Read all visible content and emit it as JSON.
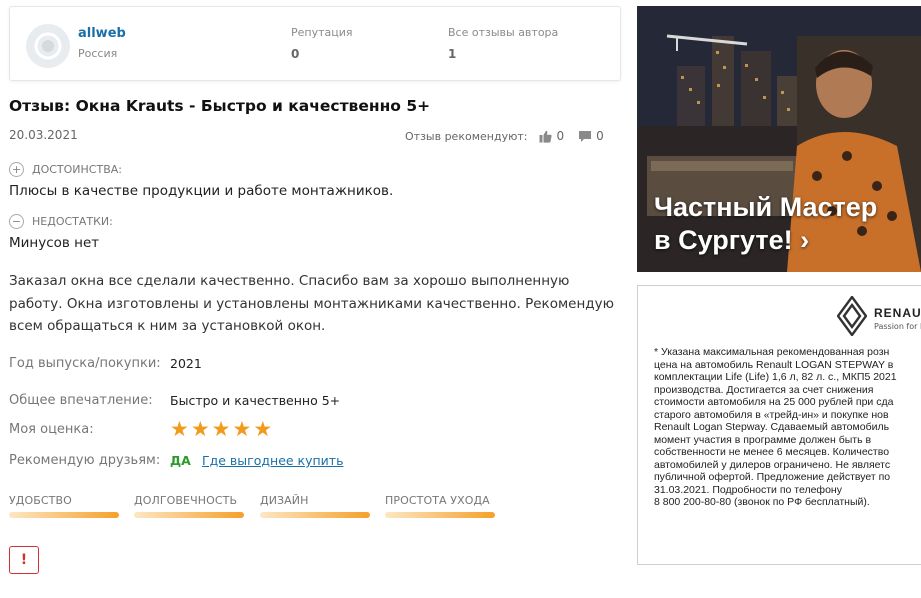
{
  "author": {
    "name": "allweb",
    "country": "Россия",
    "reputation_label": "Репутация",
    "reputation_value": "0",
    "reviews_label": "Все отзывы автора",
    "reviews_value": "1"
  },
  "review": {
    "title": "Отзыв: Окна Krauts - Быстро и качественно 5+",
    "date": "20.03.2021",
    "recommend_label": "Отзыв рекомендуют:",
    "likes": "0",
    "comments": "0",
    "pros_label": "ДОСТОИНСТВА:",
    "pros_text": "Плюсы в качестве продукции и работе монтажников.",
    "cons_label": "НЕДОСТАТКИ:",
    "cons_text": "Минусов нет",
    "body": "Заказал окна все сделали качественно. Спасибо вам за хорошо выполненную работу. Окна изготовлены и установлены монтажниками качественно. Рекомендую всем обращаться к ним за установкой окон.",
    "year_label": "Год выпуска/покупки:",
    "year_value": "2021",
    "impression_label": "Общее впечатление:",
    "impression_value": "Быстро и качественно 5+",
    "rating_label": "Моя оценка:",
    "rating": 5,
    "recommend_friends_label": "Рекомендую друзьям:",
    "recommend_friends_value": "ДА",
    "buy_link": "Где выгоднее купить",
    "criteria": [
      {
        "label": "УДОБСТВО",
        "score": 1.0
      },
      {
        "label": "ДОЛГОВЕЧНОСТЬ",
        "score": 1.0
      },
      {
        "label": "ДИЗАЙН",
        "score": 1.0
      },
      {
        "label": "ПРОСТОТА УХОДА",
        "score": 1.0
      }
    ],
    "report_button": "!"
  },
  "ads": {
    "ad1_text": "Частный Мастер\nв Сургуте! ›",
    "renault_brand": "RENAULT",
    "renault_tag": "Passion for life",
    "renault_text": "* Указана максимальная рекомендованная розн\nцена на автомобиль Renault LOGAN STEPWAY в\nкомплектации Life (Life) 1,6 л, 82 л. с., МКП5 2021\nпроизводства. Достигается за счет снижения\nстоимости автомобиля на 25 000 рублей при сда\nстарого автомобиля в «трейд-ин» и покупке нов\nRenault Logan Stepway. Сдаваемый автомобиль\nмомент участия в программе должен быть в\nсобственности не менее 6 месяцев. Количество\nавтомобилей у дилеров ограничено. Не являетс\nпубличной офертой. Предложение действует по\n31.03.2021. Подробности по телефону\n8 800 200-80-80 (звонок по РФ бесплатный)."
  },
  "colors": {
    "link": "#1a6fa8",
    "star": "#f29a1c",
    "yes": "#2c9a2c",
    "report": "#d23030"
  }
}
